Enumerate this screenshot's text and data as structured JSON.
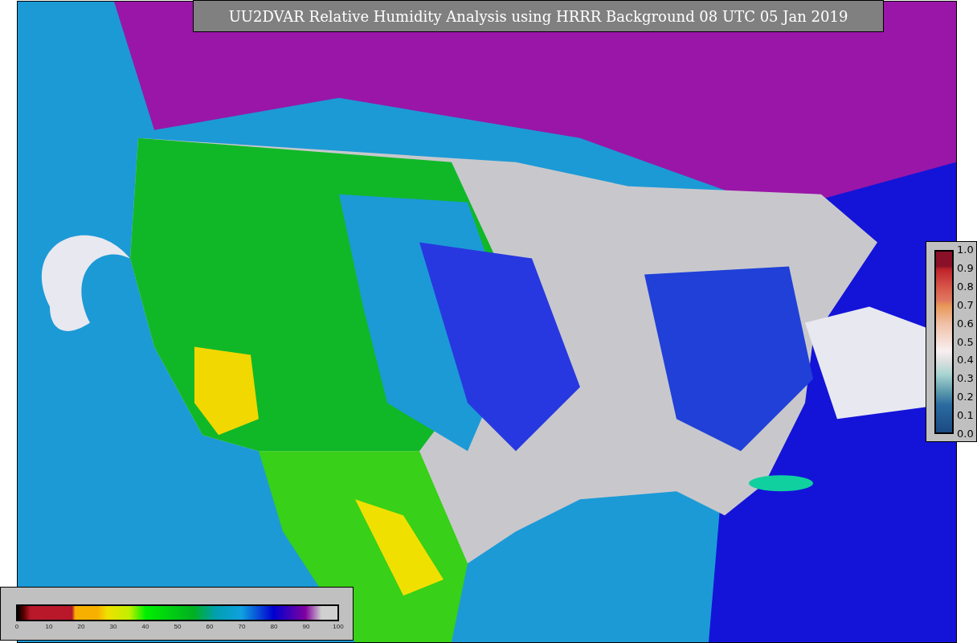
{
  "title": "UU2DVAR Relative Humidity Analysis using HRRR Background 08 UTC 05 Jan 2019",
  "humidity_colorbar": {
    "ticks": [
      "0",
      "10",
      "20",
      "30",
      "40",
      "50",
      "60",
      "70",
      "80",
      "90",
      "100"
    ]
  },
  "ratio_colorbar": {
    "ticks": [
      "1.0",
      "0.9",
      "0.8",
      "0.7",
      "0.6",
      "0.5",
      "0.4",
      "0.3",
      "0.2",
      "0.1",
      "0.0"
    ]
  }
}
